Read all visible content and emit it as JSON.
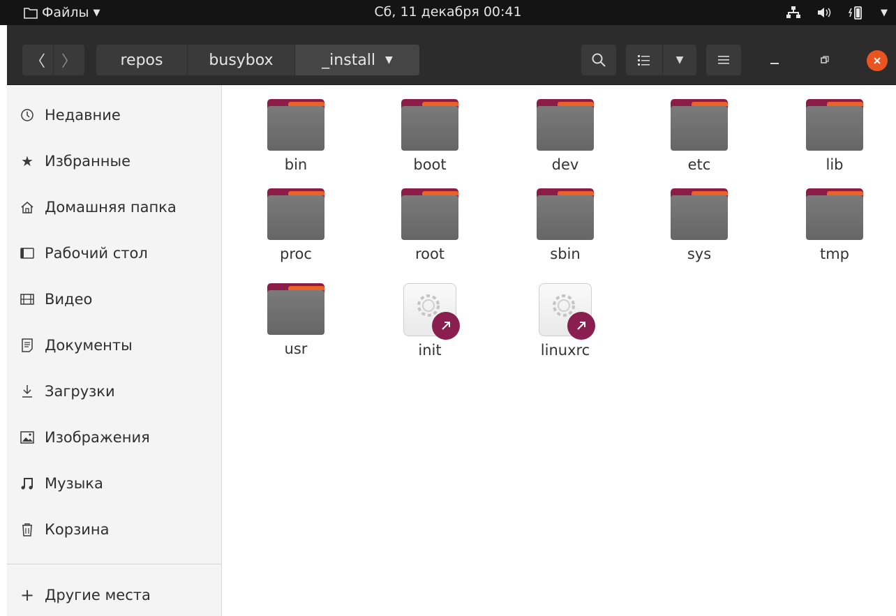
{
  "topbar": {
    "app_menu": "Файлы",
    "clock": "Сб, 11 декабря  00:41",
    "icons": [
      "network-icon",
      "volume-icon",
      "battery-icon",
      "system-menu-icon"
    ]
  },
  "headerbar": {
    "nav": [
      "back-icon",
      "forward-icon"
    ],
    "breadcrumbs": [
      "repos",
      "busybox",
      "_install"
    ],
    "actions": [
      "search-icon",
      "view-list-icon",
      "view-options-icon",
      "menu-icon"
    ],
    "window": [
      "minimize-icon",
      "restore-icon",
      "close-icon"
    ]
  },
  "sidebar": {
    "items": [
      {
        "label": "Недавние",
        "icon": "clock-icon"
      },
      {
        "label": "Избранные",
        "icon": "star-icon"
      },
      {
        "label": "Домашняя папка",
        "icon": "home-icon"
      },
      {
        "label": "Рабочий стол",
        "icon": "desktop-icon"
      },
      {
        "label": "Видео",
        "icon": "video-icon"
      },
      {
        "label": "Документы",
        "icon": "document-icon"
      },
      {
        "label": "Загрузки",
        "icon": "download-icon"
      },
      {
        "label": "Изображения",
        "icon": "image-icon"
      },
      {
        "label": "Музыка",
        "icon": "music-icon"
      },
      {
        "label": "Корзина",
        "icon": "trash-icon"
      }
    ],
    "other": {
      "label": "Другие места",
      "icon": "plus-icon"
    }
  },
  "files": [
    {
      "name": "bin",
      "kind": "folder"
    },
    {
      "name": "boot",
      "kind": "folder"
    },
    {
      "name": "dev",
      "kind": "folder"
    },
    {
      "name": "etc",
      "kind": "folder"
    },
    {
      "name": "lib",
      "kind": "folder"
    },
    {
      "name": "proc",
      "kind": "folder"
    },
    {
      "name": "root",
      "kind": "folder"
    },
    {
      "name": "sbin",
      "kind": "folder"
    },
    {
      "name": "sys",
      "kind": "folder"
    },
    {
      "name": "tmp",
      "kind": "folder"
    },
    {
      "name": "usr",
      "kind": "folder"
    },
    {
      "name": "init",
      "kind": "symlink-executable"
    },
    {
      "name": "linuxrc",
      "kind": "symlink-executable"
    }
  ],
  "colors": {
    "folder": "#6f6f6f",
    "folder_accent": "#8b1c48",
    "folder_edge": "#e8622a",
    "close": "#e95420"
  }
}
